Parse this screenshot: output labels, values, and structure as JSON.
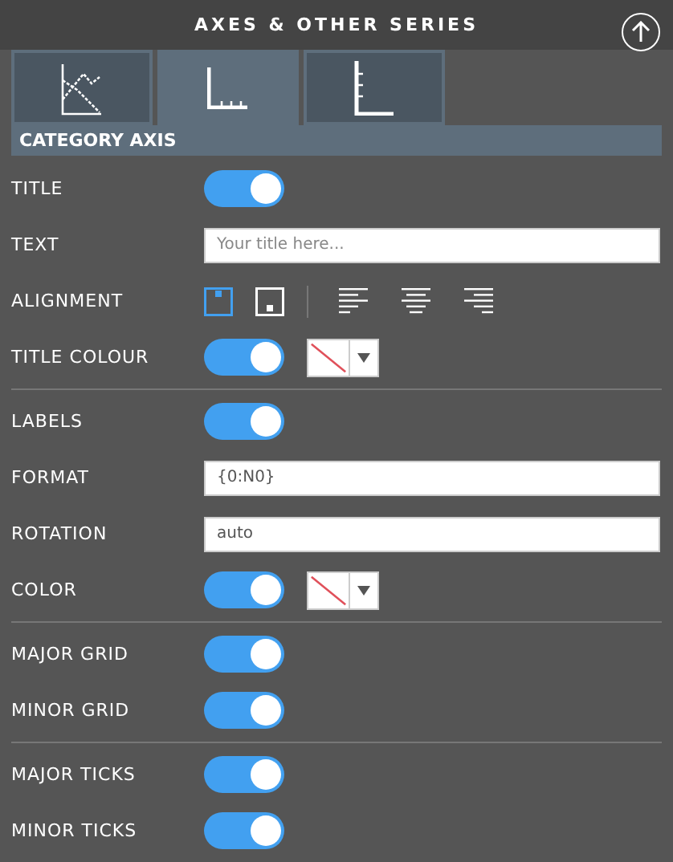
{
  "header": {
    "title": "AXES & OTHER SERIES"
  },
  "tabs": [
    {
      "kind": "series",
      "selected": false
    },
    {
      "kind": "category",
      "selected": true
    },
    {
      "kind": "value",
      "selected": false
    }
  ],
  "section": {
    "title": "CATEGORY AXIS"
  },
  "groups": [
    {
      "rows": [
        {
          "kind": "toggle",
          "label": "TITLE",
          "on": true
        },
        {
          "kind": "input",
          "label": "TEXT",
          "placeholder": "Your title here..."
        },
        {
          "kind": "alignment",
          "label": "ALIGNMENT",
          "positions": [
            {
              "kind": "top",
              "selected": true
            },
            {
              "kind": "bottom",
              "selected": false
            }
          ],
          "aligns": [
            {
              "kind": "left",
              "selected": false
            },
            {
              "kind": "center",
              "selected": false
            },
            {
              "kind": "right",
              "selected": false
            }
          ]
        },
        {
          "kind": "toggle-color",
          "label": "TITLE COLOUR",
          "on": true
        }
      ]
    },
    {
      "rows": [
        {
          "kind": "toggle",
          "label": "LABELS",
          "on": true
        },
        {
          "kind": "input",
          "label": "FORMAT",
          "value": "{0:N0}"
        },
        {
          "kind": "input",
          "label": "ROTATION",
          "value": "auto"
        },
        {
          "kind": "toggle-color",
          "label": "COLOR",
          "on": true
        }
      ]
    },
    {
      "rows": [
        {
          "kind": "toggle",
          "label": "MAJOR GRID",
          "on": true
        },
        {
          "kind": "toggle",
          "label": "MINOR GRID",
          "on": true
        }
      ]
    },
    {
      "rows": [
        {
          "kind": "toggle",
          "label": "MAJOR TICKS",
          "on": true
        },
        {
          "kind": "toggle",
          "label": "MINOR TICKS",
          "on": true
        }
      ]
    }
  ]
}
